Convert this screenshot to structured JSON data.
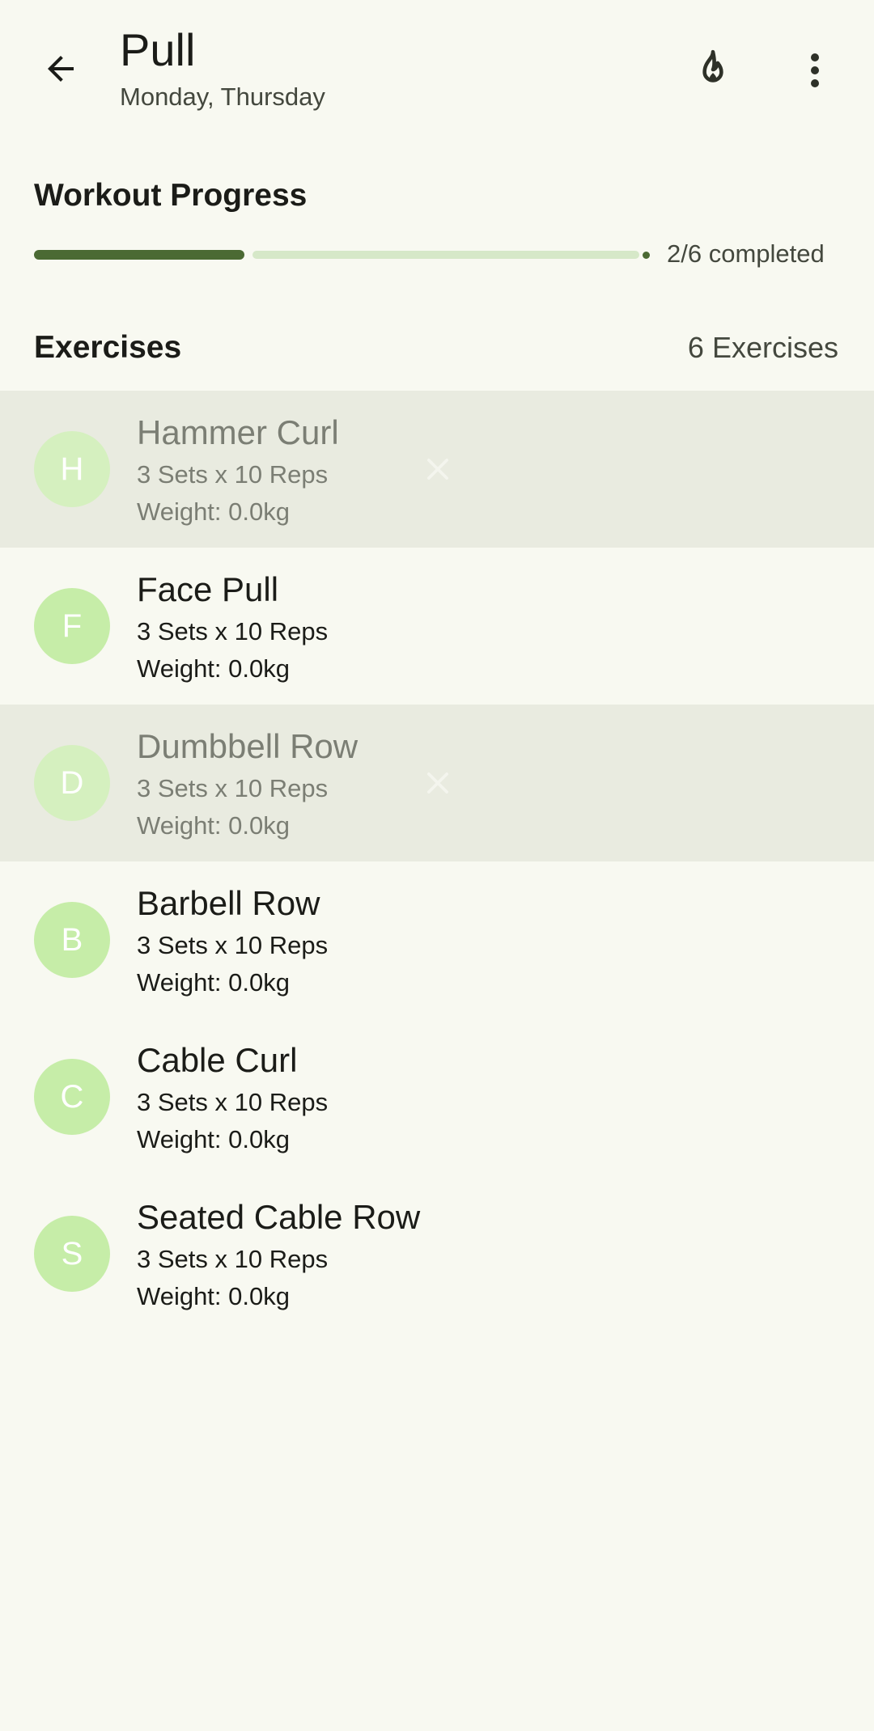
{
  "header": {
    "title": "Pull",
    "subtitle": "Monday, Thursday",
    "back_icon": "arrow-back-icon",
    "streak_icon": "fire-icon",
    "menu_icon": "more-vert-icon"
  },
  "progress": {
    "label": "Workout Progress",
    "completed": 2,
    "total": 6,
    "text": "2/6 completed"
  },
  "exercises": {
    "label": "Exercises",
    "count_text": "6 Exercises",
    "items": [
      {
        "initial": "H",
        "name": "Hammer Curl",
        "sets": "3 Sets x 10 Reps",
        "weight": "Weight: 0.0kg",
        "completed": true
      },
      {
        "initial": "F",
        "name": "Face Pull",
        "sets": "3 Sets x 10 Reps",
        "weight": "Weight: 0.0kg",
        "completed": false
      },
      {
        "initial": "D",
        "name": "Dumbbell Row",
        "sets": "3 Sets x 10 Reps",
        "weight": "Weight: 0.0kg",
        "completed": true
      },
      {
        "initial": "B",
        "name": "Barbell Row",
        "sets": "3 Sets x 10 Reps",
        "weight": "Weight: 0.0kg",
        "completed": false
      },
      {
        "initial": "C",
        "name": "Cable Curl",
        "sets": "3 Sets x 10 Reps",
        "weight": "Weight: 0.0kg",
        "completed": false
      },
      {
        "initial": "S",
        "name": "Seated Cable Row",
        "sets": "3 Sets x 10 Reps",
        "weight": "Weight: 0.0kg",
        "completed": false
      }
    ]
  },
  "colors": {
    "background": "#f8f9f1",
    "accent": "#4b6a33",
    "avatar": "#c6eda8",
    "completed_row": "#e9ebe0"
  }
}
